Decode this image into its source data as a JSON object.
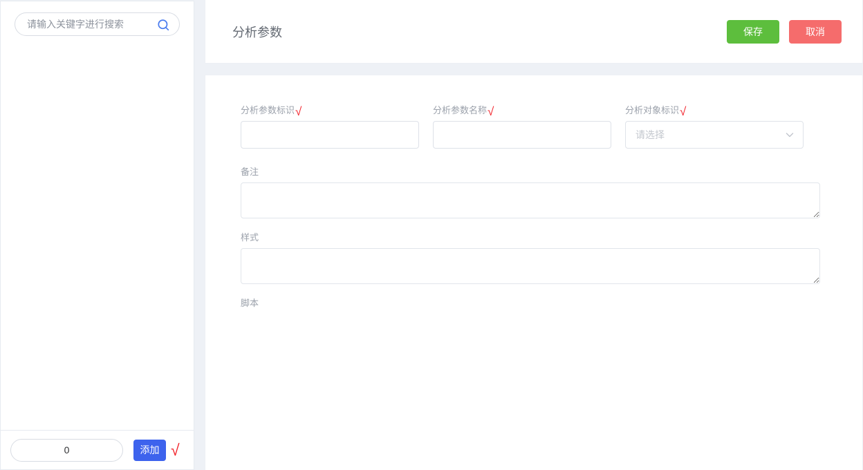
{
  "colors": {
    "accent_blue": "#3d63ed",
    "search_icon_blue": "#4a7cee",
    "success_green": "#5dbe3d",
    "danger_pink": "#f56c6c",
    "required_red": "#f2242c",
    "page_background": "#eef1f6"
  },
  "sidebar": {
    "search": {
      "placeholder": "请输入关键字进行搜索",
      "value": ""
    },
    "footer": {
      "count_value": "0",
      "add_button_label": "添加",
      "required_mark": "√"
    }
  },
  "header": {
    "title": "分析参数",
    "save_button_label": "保存",
    "cancel_button_label": "取消"
  },
  "form": {
    "fields": {
      "param_id": {
        "label": "分析参数标识",
        "required_mark": "√",
        "value": ""
      },
      "param_name": {
        "label": "分析参数名称",
        "required_mark": "√",
        "value": ""
      },
      "object_id": {
        "label": "分析对象标识",
        "required_mark": "√",
        "placeholder": "请选择"
      },
      "remarks": {
        "label": "备注",
        "value": ""
      },
      "style": {
        "label": "样式",
        "value": ""
      },
      "script": {
        "label": "脚本"
      }
    }
  }
}
